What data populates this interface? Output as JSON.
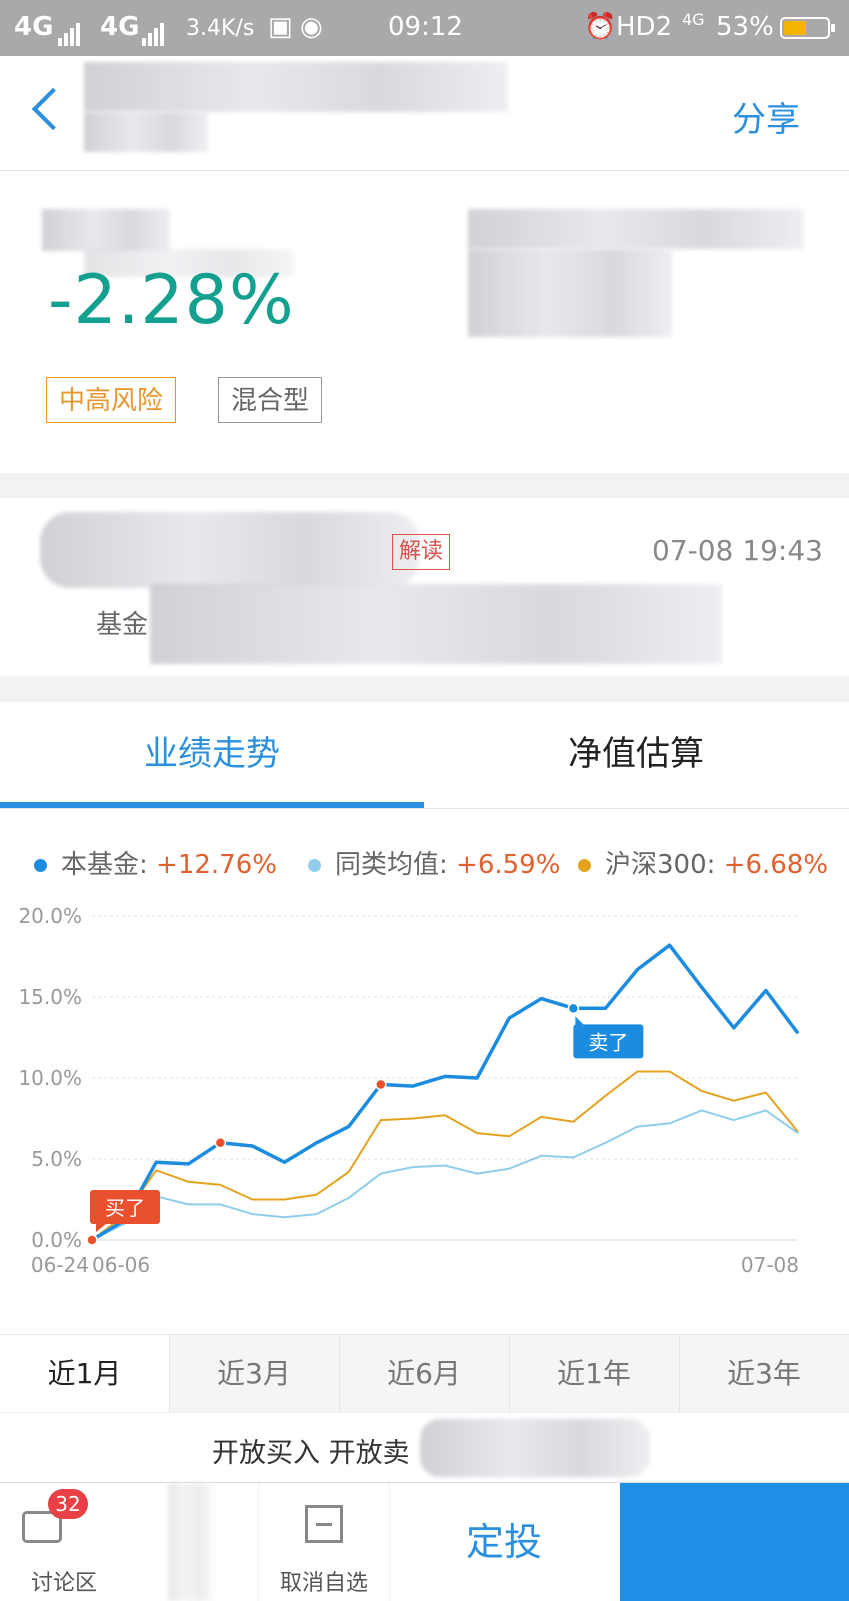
{
  "status_bar": {
    "network1": "4G",
    "network2": "4G",
    "speed": "3.4K/s",
    "time": "09:12",
    "hd": "HD2",
    "net_small": "4G",
    "battery_percent": "53%",
    "battery_level": 0.53
  },
  "header": {
    "share_label": "分享"
  },
  "fund": {
    "return_rate": "-2.28%",
    "tags": [
      "中高风险",
      "混合型"
    ]
  },
  "news": {
    "tag": "解读",
    "time": "07-08 19:43",
    "snippet": "基金"
  },
  "tabs": [
    "业绩走势",
    "净值估算"
  ],
  "legend": [
    {
      "name": "本基金:",
      "value": "+12.76%",
      "color": "#1c8ce0"
    },
    {
      "name": "同类均值:",
      "value": "+6.59%",
      "color": "#8fcdea"
    },
    {
      "name": "沪深300:",
      "value": "+6.68%",
      "color": "#e3a321"
    }
  ],
  "chart_data": {
    "type": "line",
    "x": [
      "06-06",
      "06-07",
      "06-08",
      "06-11",
      "06-12",
      "06-13",
      "06-14",
      "06-15",
      "06-19",
      "06-20",
      "06-21",
      "06-22",
      "06-25",
      "06-26",
      "06-27",
      "06-28",
      "06-29",
      "07-02",
      "07-03",
      "07-04",
      "07-05",
      "07-06",
      "07-08"
    ],
    "xticks": [
      "06-06",
      "06-24",
      "07-08"
    ],
    "yticks": [
      "0.0%",
      "5.0%",
      "10.0%",
      "15.0%",
      "20.0%"
    ],
    "ylim": [
      0,
      20
    ],
    "series": [
      {
        "name": "本基金",
        "color": "#1c8ce0",
        "values": [
          0.0,
          1.2,
          4.8,
          4.7,
          6.0,
          5.8,
          4.8,
          6.0,
          7.0,
          9.6,
          9.5,
          10.1,
          10.0,
          13.7,
          14.9,
          14.3,
          14.3,
          16.7,
          18.2,
          15.6,
          13.1,
          15.4,
          12.76
        ]
      },
      {
        "name": "同类均值",
        "color": "#8fcdea",
        "values": [
          0.0,
          1.0,
          2.7,
          2.2,
          2.2,
          1.6,
          1.4,
          1.6,
          2.6,
          4.1,
          4.5,
          4.6,
          4.1,
          4.4,
          5.2,
          5.1,
          6.0,
          7.0,
          7.2,
          8.0,
          7.4,
          8.0,
          6.59
        ]
      },
      {
        "name": "沪深300",
        "color": "#e3a321",
        "values": [
          0.0,
          1.5,
          4.3,
          3.6,
          3.4,
          2.5,
          2.5,
          2.8,
          4.2,
          7.4,
          7.5,
          7.7,
          6.6,
          6.4,
          7.6,
          7.3,
          8.9,
          10.4,
          10.4,
          9.2,
          8.6,
          9.1,
          6.68
        ]
      }
    ],
    "buy_points": [
      0,
      4,
      9
    ],
    "sell_points": [
      15
    ],
    "buy_label": "买了",
    "sell_label": "卖了"
  },
  "periods": [
    "近1月",
    "近3月",
    "近6月",
    "近1年",
    "近3年"
  ],
  "trade_status": "开放买入 开放卖",
  "bottom": {
    "discuss_label": "讨论区",
    "badge": "32",
    "unfav_label": "取消自选",
    "dingtou_label": "定投"
  }
}
